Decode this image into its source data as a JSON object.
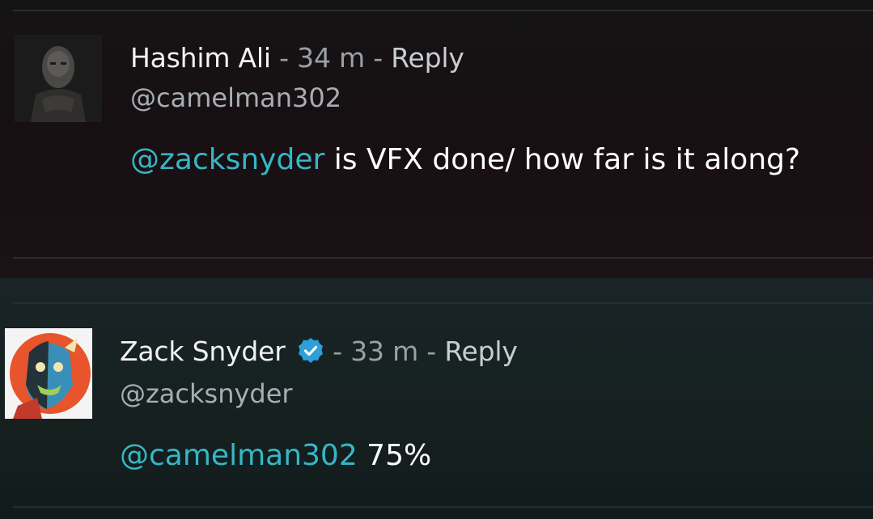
{
  "comments": [
    {
      "author_name": "Hashim Ali",
      "separator_1": " - ",
      "time": "34 m",
      "separator_2": " - ",
      "reply_label": "Reply",
      "handle": "@camelman302",
      "mention": "@zacksnyder",
      "text": " is VFX done/ how far is it along?",
      "verified": false
    },
    {
      "author_name": "Zack Snyder",
      "separator_1": " - ",
      "time": "33 m",
      "separator_2": " - ",
      "reply_label": "Reply",
      "handle": "@zacksnyder",
      "mention": "@camelman302",
      "text": " 75%",
      "verified": true
    }
  ],
  "colors": {
    "mention": "#35b7c6",
    "verified_badge": "#2d9fd9",
    "top_panel": "#160f12",
    "bottom_panel": "#172225"
  }
}
